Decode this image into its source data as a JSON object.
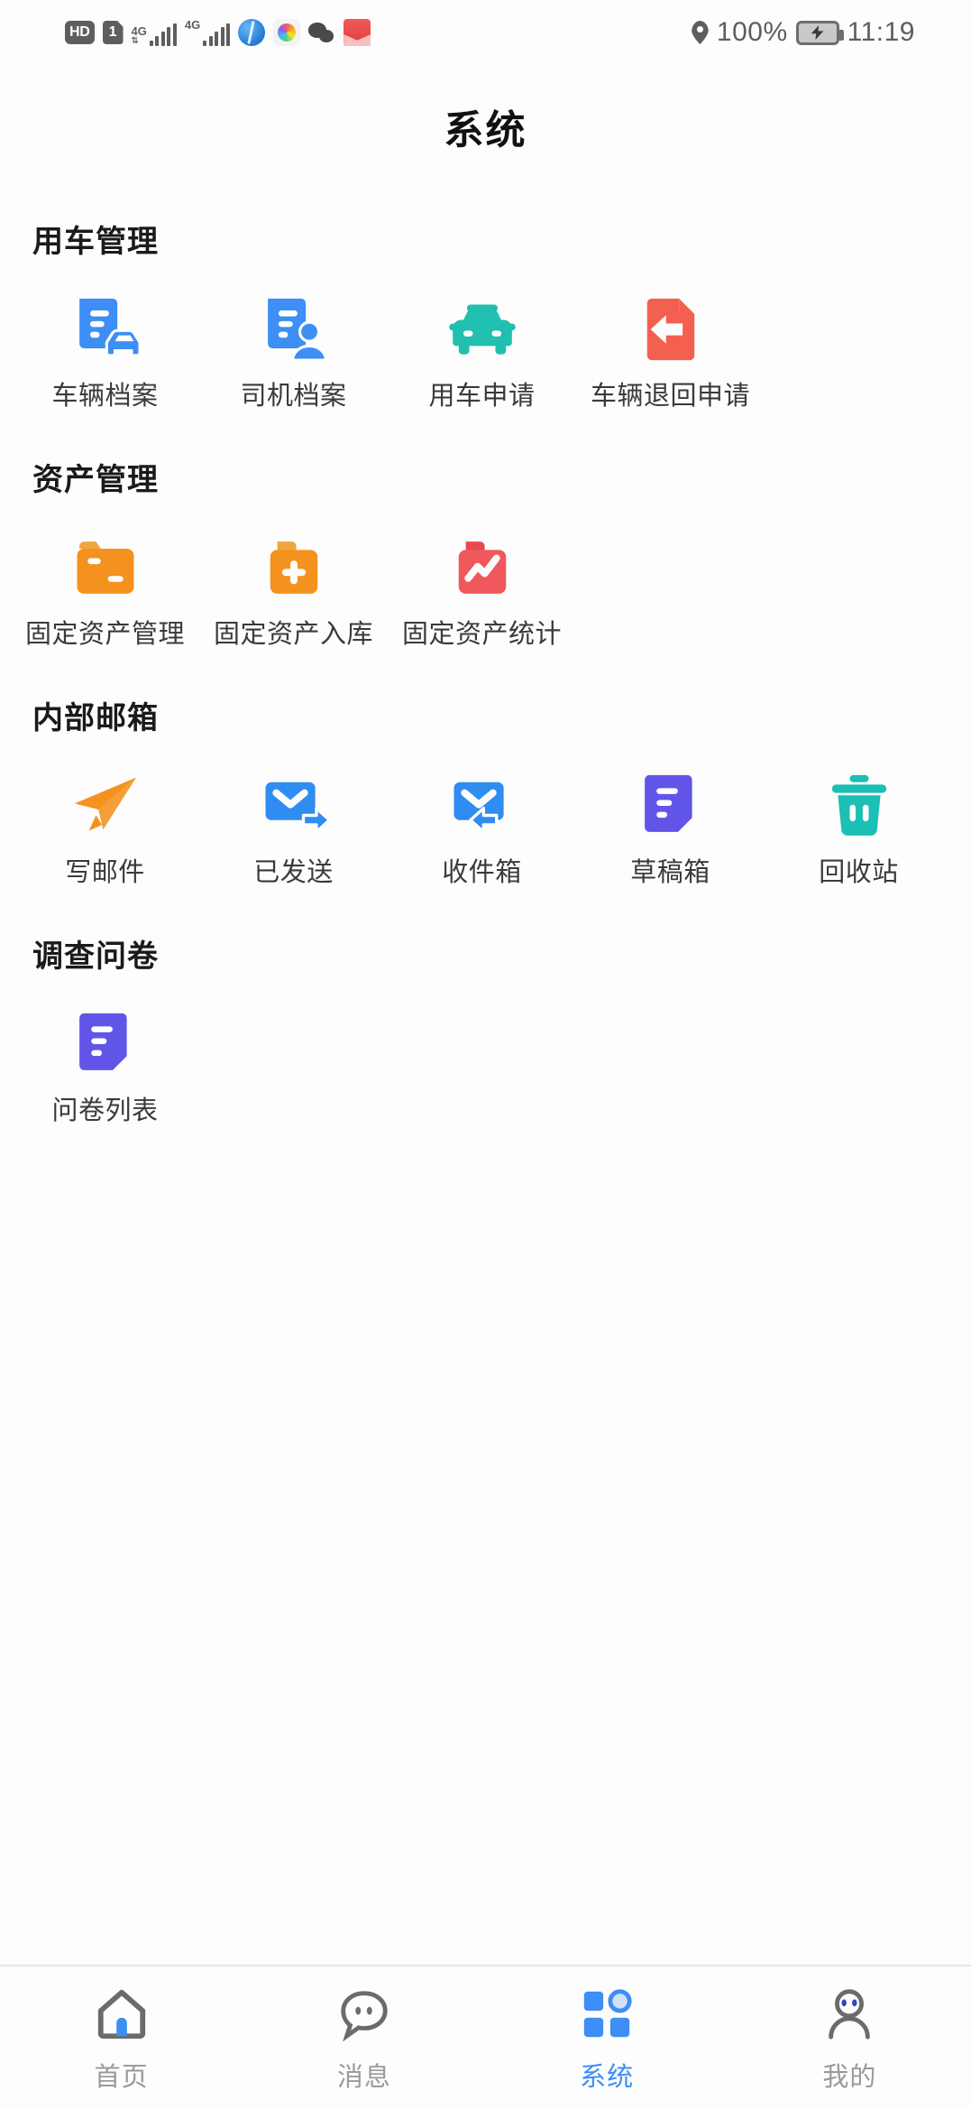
{
  "status_bar": {
    "hd_badge": "HD",
    "sim_badge": "1",
    "network_1": "4G",
    "network_2": "4G",
    "battery_percent": "100%",
    "time": "11:19",
    "icons": [
      "hd-badge",
      "sim-card-icon",
      "signal-4g-icon",
      "signal-4g-icon",
      "browser-app-icon",
      "photos-app-icon",
      "wechat-app-icon",
      "mail-app-icon",
      "location-pin-icon",
      "battery-charging-icon"
    ]
  },
  "header": {
    "title": "系统"
  },
  "sections": [
    {
      "title": "用车管理",
      "items": [
        {
          "label": "车辆档案",
          "icon": "vehicle-file-icon",
          "color": "#3d8ef5"
        },
        {
          "label": "司机档案",
          "icon": "driver-file-icon",
          "color": "#3d8ef5"
        },
        {
          "label": "用车申请",
          "icon": "car-request-icon",
          "color": "#21bfb0"
        },
        {
          "label": "车辆退回申请",
          "icon": "vehicle-return-icon",
          "color": "#f4604f"
        }
      ]
    },
    {
      "title": "资产管理",
      "items": [
        {
          "label": "固定资产管理",
          "icon": "asset-folder-icon",
          "color": "#f5911e"
        },
        {
          "label": "固定资产入库",
          "icon": "asset-add-folder-icon",
          "color": "#f5911e"
        },
        {
          "label": "固定资产统计",
          "icon": "asset-stats-folder-icon",
          "color": "#f0585b"
        }
      ]
    },
    {
      "title": "内部邮箱",
      "items": [
        {
          "label": "写邮件",
          "icon": "compose-mail-icon",
          "color": "#f5911e"
        },
        {
          "label": "已发送",
          "icon": "sent-mail-icon",
          "color": "#2f8cf0"
        },
        {
          "label": "收件箱",
          "icon": "inbox-mail-icon",
          "color": "#2f8cf0"
        },
        {
          "label": "草稿箱",
          "icon": "draft-document-icon",
          "color": "#6155e8"
        },
        {
          "label": "回收站",
          "icon": "trash-bin-icon",
          "color": "#1cbfb4"
        }
      ]
    },
    {
      "title": "调查问卷",
      "items": [
        {
          "label": "问卷列表",
          "icon": "questionnaire-list-icon",
          "color": "#6155e8"
        }
      ]
    }
  ],
  "tabbar": {
    "active_index": 2,
    "items": [
      {
        "label": "首页",
        "icon": "home-icon"
      },
      {
        "label": "消息",
        "icon": "message-bubble-icon"
      },
      {
        "label": "系统",
        "icon": "grid-apps-icon"
      },
      {
        "label": "我的",
        "icon": "profile-person-icon"
      }
    ]
  },
  "theme": {
    "accent": "#3d8ef5",
    "inactive_tab": "#9a9a9a",
    "text": "#3a3a3a",
    "background": "#fdfdfd"
  }
}
